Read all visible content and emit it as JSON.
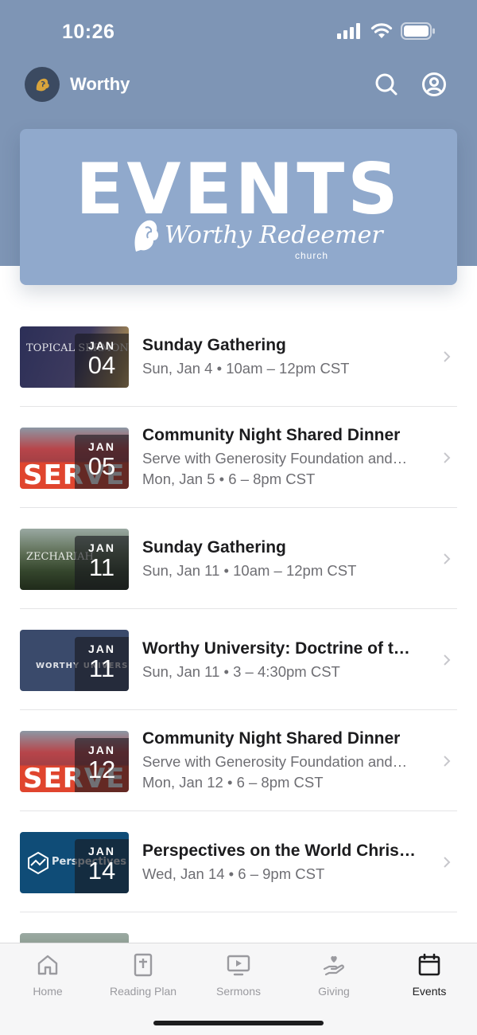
{
  "status_bar": {
    "time": "10:26"
  },
  "header": {
    "app_name": "Worthy",
    "search_icon": "search-icon",
    "profile_icon": "profile-icon"
  },
  "banner": {
    "title": "EVENTS",
    "brand": "Worthy Redeemer",
    "brand_sub": "church"
  },
  "events": [
    {
      "title": "Sunday Gathering",
      "line1": "Sun, Jan 4 • 10am – 12pm CST",
      "line2": "",
      "month": "JAN",
      "day": "04",
      "thumb_text": "TOPICAL SERMONS"
    },
    {
      "title": "Community Night Shared Dinner",
      "line1": "Serve with Generosity Foundation and…",
      "line2": "Mon, Jan 5 • 6 – 8pm CST",
      "month": "JAN",
      "day": "05",
      "thumb_text": "SERVE"
    },
    {
      "title": "Sunday Gathering",
      "line1": "Sun, Jan 11 • 10am – 12pm CST",
      "line2": "",
      "month": "JAN",
      "day": "11",
      "thumb_text": "ZECHARIAH"
    },
    {
      "title": "Worthy University: Doctrine of t…",
      "line1": "Sun, Jan 11 • 3 – 4:30pm CST",
      "line2": "",
      "month": "JAN",
      "day": "11",
      "thumb_text": "WORTHY UNIVERSITY"
    },
    {
      "title": "Community Night Shared Dinner",
      "line1": "Serve with Generosity Foundation and…",
      "line2": "Mon, Jan 12 • 6 – 8pm CST",
      "month": "JAN",
      "day": "12",
      "thumb_text": "SERVE"
    },
    {
      "title": "Perspectives on the World Chris…",
      "line1": "Wed, Jan 14 • 6 – 9pm CST",
      "line2": "",
      "month": "JAN",
      "day": "14",
      "thumb_text": "Perspectives"
    }
  ],
  "tabs": [
    {
      "label": "Home",
      "icon": "home-icon",
      "active": false
    },
    {
      "label": "Reading Plan",
      "icon": "bible-icon",
      "active": false
    },
    {
      "label": "Sermons",
      "icon": "video-icon",
      "active": false
    },
    {
      "label": "Giving",
      "icon": "giving-hand-icon",
      "active": false
    },
    {
      "label": "Events",
      "icon": "calendar-icon",
      "active": true
    }
  ],
  "colors": {
    "header_bg": "#7e95b5",
    "banner_bg": "#90a9cc",
    "text_primary": "#1c1c1e",
    "text_secondary": "#6e6e73",
    "tab_inactive": "#9a9a9f"
  }
}
